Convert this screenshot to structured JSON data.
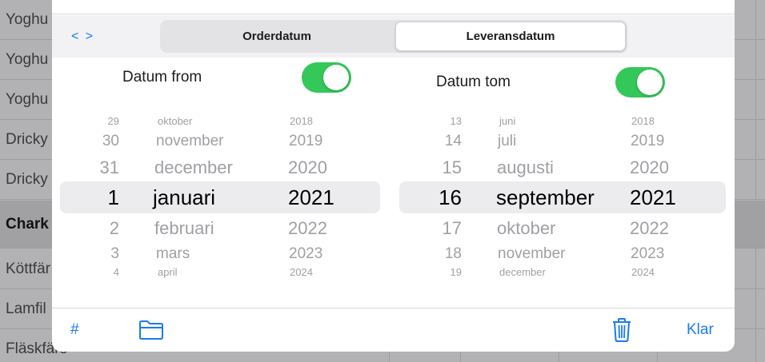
{
  "background_list": {
    "rows": [
      "Yoghu",
      "Yoghu",
      "Yoghu",
      "Dricky",
      "Dricky",
      "Chark",
      "Köttfär",
      "Lamfil",
      "Fläskfärs"
    ]
  },
  "header": {
    "nav_arrows": "< >",
    "segments": [
      "Orderdatum",
      "Leveransdatum"
    ],
    "selected_segment": "Leveransdatum"
  },
  "from": {
    "label": "Datum from",
    "enabled": true,
    "days": [
      "29",
      "30",
      "31",
      "1",
      "2",
      "3",
      "4"
    ],
    "months": [
      "oktober",
      "november",
      "december",
      "januari",
      "februari",
      "mars",
      "april"
    ],
    "years": [
      "2018",
      "2019",
      "2020",
      "2021",
      "2022",
      "2023",
      "2024"
    ]
  },
  "tom": {
    "label": "Datum tom",
    "enabled": true,
    "days": [
      "13",
      "14",
      "15",
      "16",
      "17",
      "18",
      "19"
    ],
    "months": [
      "juni",
      "juli",
      "augusti",
      "september",
      "oktober",
      "november",
      "december"
    ],
    "years": [
      "2018",
      "2019",
      "2020",
      "2021",
      "2022",
      "2023",
      "2024"
    ]
  },
  "footer": {
    "hash_label": "#",
    "folder_icon": "folder-icon",
    "trash_icon": "trash-icon",
    "done_label": "Klar"
  },
  "colors": {
    "accent": "#1a7bf2",
    "switch_on": "#34c759"
  }
}
